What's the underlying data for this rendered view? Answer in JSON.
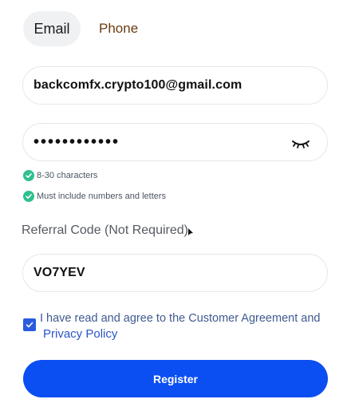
{
  "tabs": {
    "email_label": "Email",
    "phone_label": "Phone",
    "active": "Email"
  },
  "email_field": {
    "value": "backcomfx.crypto100@gmail.com"
  },
  "password_field": {
    "value": "••••••••••••",
    "toggle_icon": "eye-closed-icon"
  },
  "requirements": [
    {
      "text": "8-30 characters",
      "met": true
    },
    {
      "text": "Must include numbers and letters",
      "met": true
    }
  ],
  "referral": {
    "label": "Referral Code (Not Required).",
    "value": "VO7YEV"
  },
  "agreement": {
    "checked": true,
    "text": "I have read and agree to the Customer Agreement and",
    "privacy_link": "Privacy Policy"
  },
  "register_label": "Register",
  "colors": {
    "primary": "#0b4ef2",
    "success": "#2fc08d",
    "phone_tab": "#6b3a12",
    "link": "#2a55c8"
  }
}
